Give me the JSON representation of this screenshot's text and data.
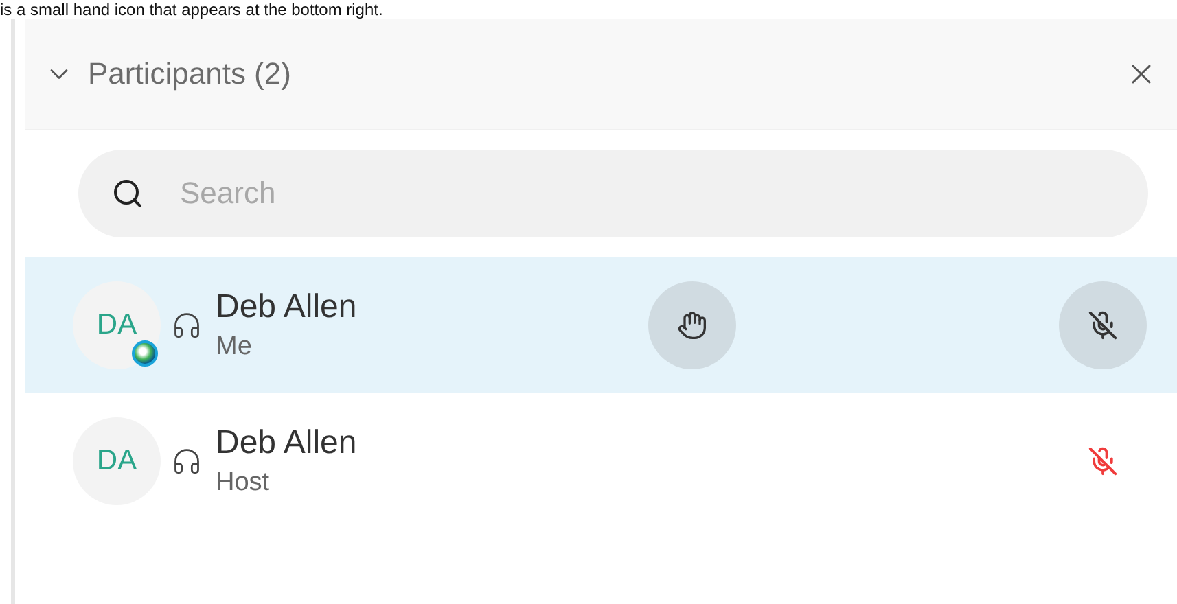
{
  "caption": "is a small hand icon that appears at the bottom right.",
  "panel": {
    "title": "Participants (2)",
    "expanded": true
  },
  "search": {
    "placeholder": "Search"
  },
  "participants": [
    {
      "initials": "DA",
      "name": "Deb Allen",
      "role": "Me",
      "selected": true,
      "presence_badge": true,
      "hand_button": true,
      "mic": {
        "kind": "button"
      }
    },
    {
      "initials": "DA",
      "name": "Deb Allen",
      "role": "Host",
      "selected": false,
      "presence_badge": false,
      "hand_button": false,
      "mic": {
        "kind": "alert"
      }
    }
  ]
}
